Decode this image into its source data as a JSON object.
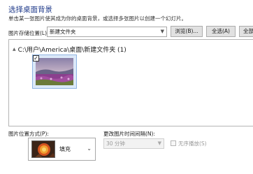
{
  "header": {
    "title": "选择桌面背景",
    "subtitle": "单击某一张图片使其成为你的桌面背景，或选择多张图片以创建一个幻灯片。"
  },
  "location": {
    "label": "图片存储位置(L):",
    "value": "新建文件夹",
    "dropdown_icon": "chevron-down-icon"
  },
  "buttons": {
    "browse": "浏览(B)...",
    "select_all": "全选(A)",
    "clear_all": "全部"
  },
  "gallery": {
    "group_title": "C:\\用户\\America\\桌面\\新建文件夹 (1)",
    "items": [
      {
        "checked": true,
        "check_mark": "✓"
      }
    ]
  },
  "position": {
    "label": "图片位置方式(P):",
    "value": "填充"
  },
  "interval": {
    "label": "更改图片时间间隔(N):",
    "value": "30 分钟",
    "enabled": false
  },
  "shuffle": {
    "label": "无序播放(S)",
    "checked": false,
    "enabled": false
  },
  "colors": {
    "title": "#1f3a8a",
    "selection_border": "#8eb4e3",
    "selection_fill": "#dbe8f8",
    "disabled_text": "#9a9a9a"
  }
}
